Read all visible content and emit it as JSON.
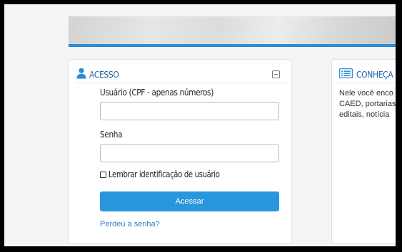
{
  "access_card": {
    "title": "ACESSO",
    "username_label": "Usuário (CPF - apenas números)",
    "username_value": "",
    "password_label": "Senha",
    "password_value": "",
    "remember_label": "Lembrar identificação de usuário",
    "remember_checked": false,
    "submit_label": "Acessar",
    "forgot_link": "Perdeu a senha?"
  },
  "info_card": {
    "title": "CONHEÇA O",
    "text_lines": [
      "Nele você enco",
      "CAED, portarias",
      "editais, notícia"
    ]
  },
  "icons": {
    "access": "user-icon",
    "info": "list-icon",
    "collapse": "collapse-icon"
  },
  "colors": {
    "accent": "#2b8cd6",
    "button": "#2a96dd",
    "title": "#1f63a6",
    "link": "#2a7fc9"
  }
}
